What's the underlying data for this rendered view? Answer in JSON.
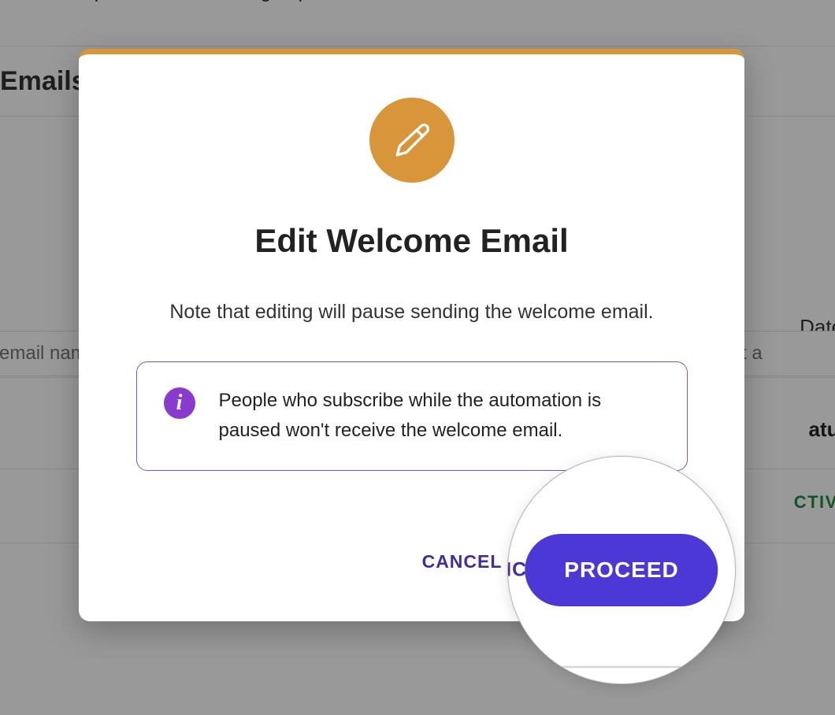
{
  "page": {
    "intro_text_visible": "up and is added to a group, the workflow will send an automatic welcome email.",
    "section_title": "Emails",
    "table": {
      "search_placeholder": "email nam",
      "date_filter_label": "Date",
      "date_select_placeholder": "Select a",
      "status_header": "atus",
      "row_status_badge": "CTIVE"
    }
  },
  "modal": {
    "title": "Edit Welcome Email",
    "note": "Note that editing will pause sending the welcome email.",
    "info_text": "People who subscribe while the automation is paused won't receive the welcome email.",
    "cancel_label": "CANCEL",
    "proceed_label": "PROCEED"
  },
  "colors": {
    "accent_orange": "#d8953a",
    "primary_purple": "#4b38d6",
    "info_border": "#8a4fc4"
  }
}
